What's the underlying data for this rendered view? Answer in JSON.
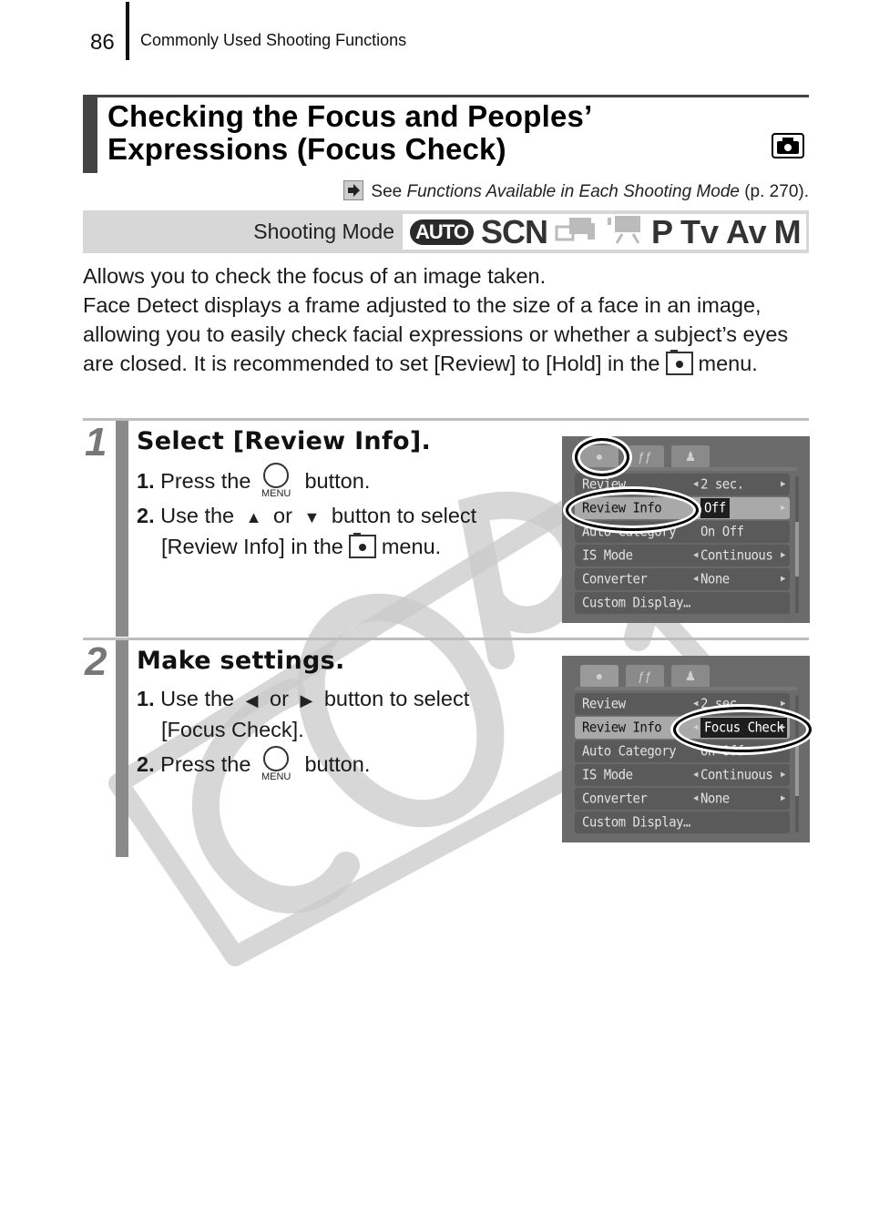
{
  "header": {
    "page_number": "86",
    "section": "Commonly Used Shooting Functions"
  },
  "title": {
    "line1": "Checking the Focus and Peoples’",
    "line2": "Expressions (Focus Check)",
    "mode_icon": "camera-icon"
  },
  "see_reference": {
    "prefix": "See ",
    "italic": "Functions Available in Each Shooting Mode",
    "suffix": " (p. 270).",
    "icon": "arrow-right-icon"
  },
  "shooting_mode": {
    "label": "Shooting Mode",
    "modes": [
      {
        "label": "AUTO",
        "available": true
      },
      {
        "label": "SCN",
        "available": true
      },
      {
        "label": "stitch-assist",
        "available": false
      },
      {
        "label": "movie",
        "available": false
      },
      {
        "label": "P",
        "available": true
      },
      {
        "label": "Tv",
        "available": true
      },
      {
        "label": "Av",
        "available": true
      },
      {
        "label": "M",
        "available": true
      }
    ]
  },
  "intro": {
    "para1": "Allows you to check the focus of an image taken.",
    "para2_a": "Face Detect displays a frame adjusted to the size of a face in an image, allowing you to easily check facial expressions or whether a subject’s eyes are closed. It is recommended to set [Review] to [Hold] in the",
    "para2_b": "menu."
  },
  "steps": [
    {
      "number": "1",
      "title": "Select [Review Info].",
      "items": [
        {
          "num": "1.",
          "pre": "Press the",
          "icon": "menu-button",
          "icon_label": "MENU",
          "post": "button."
        },
        {
          "num": "2.",
          "pre": "Use the",
          "arrow1": "▲",
          "mid": "or",
          "arrow2": "▼",
          "post": "button to select",
          "line2_pre": "[Review Info] in the",
          "line2_post": "menu."
        }
      ],
      "screen": {
        "tabs": [
          "camera",
          "settings",
          "my-menu"
        ],
        "rows": [
          {
            "name": "Review",
            "value": "2 sec."
          },
          {
            "name": "Review Info",
            "value": "Off"
          },
          {
            "name": "Auto Category",
            "value": "On  Off"
          },
          {
            "name": "IS Mode",
            "value": "Continuous"
          },
          {
            "name": "Converter",
            "value": "None"
          },
          {
            "name": "Custom Display…",
            "value": ""
          }
        ]
      }
    },
    {
      "number": "2",
      "title": "Make settings.",
      "items": [
        {
          "num": "1.",
          "pre": "Use the",
          "arrow1": "◀",
          "mid": "or",
          "arrow2": "▶",
          "post": "button to select",
          "line2_pre": "[Focus Check].",
          "line2_post": ""
        },
        {
          "num": "2.",
          "pre": "Press the",
          "icon": "menu-button",
          "icon_label": "MENU",
          "post": "button."
        }
      ],
      "screen": {
        "tabs": [
          "camera",
          "settings",
          "my-menu"
        ],
        "rows": [
          {
            "name": "Review",
            "value": "2 sec."
          },
          {
            "name": "Review Info",
            "value": "Focus Check"
          },
          {
            "name": "Auto Category",
            "value": "On  Off"
          },
          {
            "name": "IS Mode",
            "value": "Continuous"
          },
          {
            "name": "Converter",
            "value": "None"
          },
          {
            "name": "Custom Display…",
            "value": ""
          }
        ]
      }
    }
  ],
  "watermark": "COPY"
}
